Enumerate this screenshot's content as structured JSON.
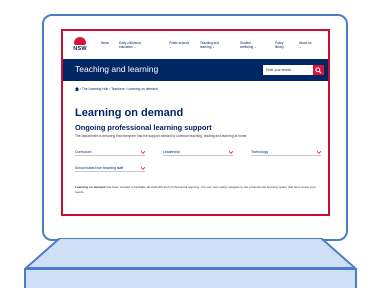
{
  "brand": {
    "logo_text": "NSW",
    "accent": "#d7153a",
    "navy": "#002664"
  },
  "nav": {
    "items": [
      {
        "label": "News"
      },
      {
        "label": "Early childhood education ⌄"
      },
      {
        "label": "Public schools ⌄"
      },
      {
        "label": "Teaching and learning ⌄"
      },
      {
        "label": "Student wellbeing ⌄"
      },
      {
        "label": "Policy library"
      },
      {
        "label": "About us ⌄"
      }
    ]
  },
  "banner": {
    "title": "Teaching and learning",
    "search_placeholder": "Enter your search...",
    "search_icon": "search-icon"
  },
  "breadcrumb": {
    "text": "› The Learning Hub › Teachers › Learning on demand"
  },
  "page": {
    "title": "Learning on demand",
    "subtitle": "Ongoing professional learning support",
    "lede": "The department is ensuring that everyone has the support needed to continue teaching, leading and learning at home."
  },
  "filters": [
    {
      "label": "Curriculum"
    },
    {
      "label": "Leadership"
    },
    {
      "label": "Technology"
    },
    {
      "label": "School based non teaching staff"
    }
  ],
  "footer": {
    "bold": "Learning on demand",
    "rest": " has been created to facilitate all staff with their professional learning. You can now easily navigate to the professional learning option that best meets your needs."
  }
}
